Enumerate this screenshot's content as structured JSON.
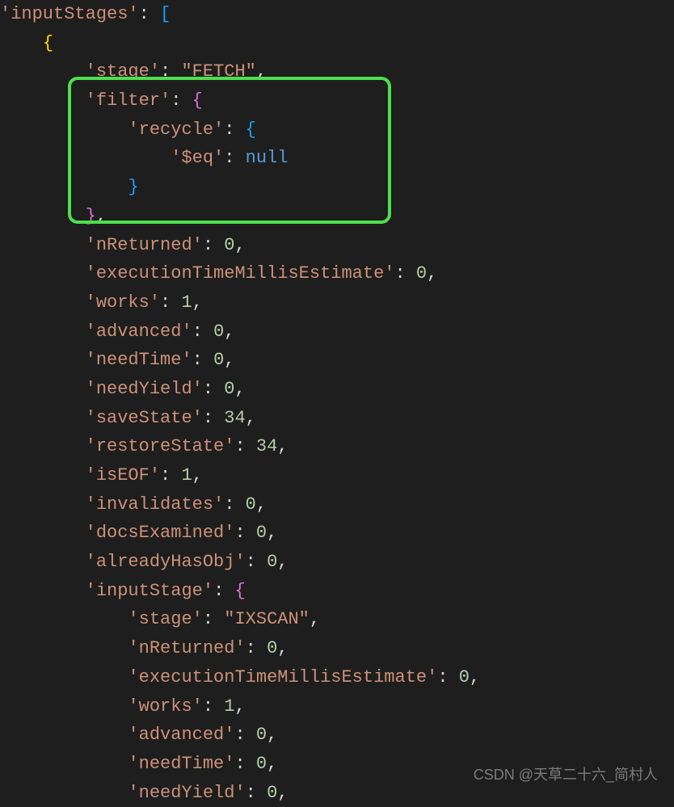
{
  "code": {
    "rootKey": "'inputStages'",
    "lines": {
      "l1": {
        "key": "'inputStages'",
        "open": "["
      },
      "l3": {
        "key": "'stage'",
        "val": "\"FETCH\""
      },
      "l4": {
        "key": "'filter'"
      },
      "l5": {
        "key": "'recycle'"
      },
      "l6": {
        "key": "'$eq'",
        "val": "null"
      },
      "l9": {
        "key": "'nReturned'",
        "val": "0"
      },
      "l10": {
        "key": "'executionTimeMillisEstimate'",
        "val": "0"
      },
      "l11": {
        "key": "'works'",
        "val": "1"
      },
      "l12": {
        "key": "'advanced'",
        "val": "0"
      },
      "l13": {
        "key": "'needTime'",
        "val": "0"
      },
      "l14": {
        "key": "'needYield'",
        "val": "0"
      },
      "l15": {
        "key": "'saveState'",
        "val": "34"
      },
      "l16": {
        "key": "'restoreState'",
        "val": "34"
      },
      "l17": {
        "key": "'isEOF'",
        "val": "1"
      },
      "l18": {
        "key": "'invalidates'",
        "val": "0"
      },
      "l19": {
        "key": "'docsExamined'",
        "val": "0"
      },
      "l20": {
        "key": "'alreadyHasObj'",
        "val": "0"
      },
      "l21": {
        "key": "'inputStage'"
      },
      "l22": {
        "key": "'stage'",
        "val": "\"IXSCAN\""
      },
      "l23": {
        "key": "'nReturned'",
        "val": "0"
      },
      "l24": {
        "key": "'executionTimeMillisEstimate'",
        "val": "0"
      },
      "l25": {
        "key": "'works'",
        "val": "1"
      },
      "l26": {
        "key": "'advanced'",
        "val": "0"
      },
      "l27": {
        "key": "'needTime'",
        "val": "0"
      },
      "l28": {
        "key": "'needYield'",
        "val": "0"
      }
    }
  },
  "watermark": "CSDN @天草二十六_简村人"
}
